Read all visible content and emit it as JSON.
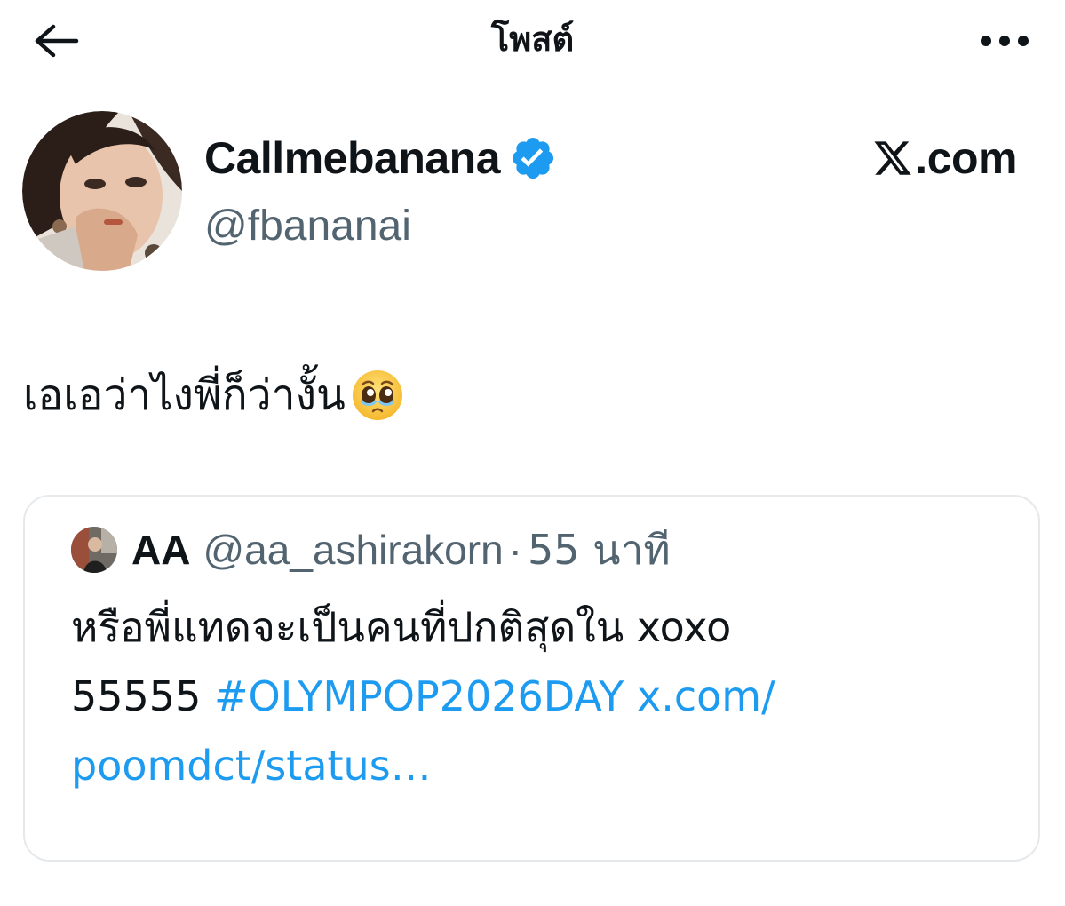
{
  "topbar": {
    "back_icon": "arrow-left-icon",
    "title": "โพสต์",
    "more_icon": "more-horizontal-icon"
  },
  "author": {
    "display_name": "Callmebanana",
    "verified": true,
    "handle": "@fbananai",
    "avatar_icon": "avatar-photo"
  },
  "brand": {
    "logo_icon": "x-logo-icon",
    "text": ".com"
  },
  "post": {
    "text": "เอเอว่าไงพี่ก็ว่างั้น",
    "emoji": "pleading-face-emoji"
  },
  "quote": {
    "name": "AA",
    "handle": "@aa_ashirakorn",
    "separator": "·",
    "time": "55 นาที",
    "line1": "หรือพี่แทดจะเป็นคนที่ปกติสุดใน xoxo",
    "line2_prefix": "55555 ",
    "hashtag": "#OLYMPOP2026DAY",
    "link_part1": "x.com/",
    "link_part2": "poomdct/status…"
  },
  "colors": {
    "text_primary": "#0f1419",
    "text_secondary": "#536471",
    "accent_blue": "#1d9bf0",
    "border": "#e6e9ec"
  }
}
